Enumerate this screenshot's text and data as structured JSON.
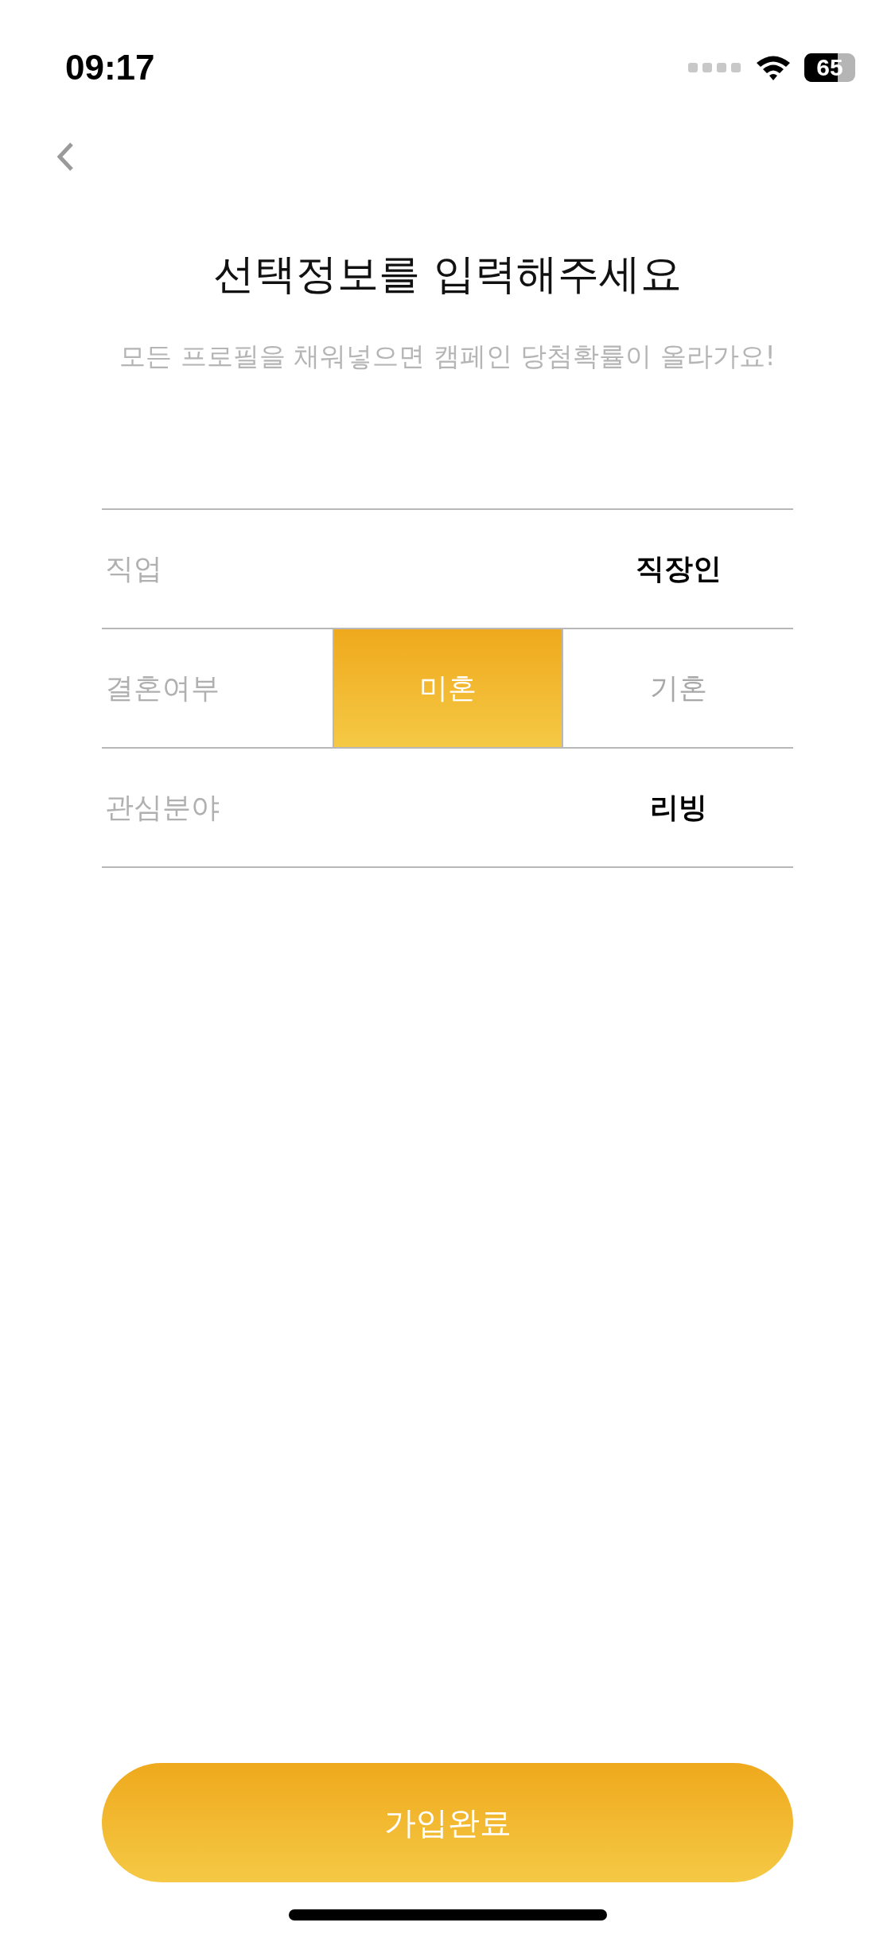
{
  "status_bar": {
    "time": "09:17",
    "battery": "65"
  },
  "title": "선택정보를 입력해주세요",
  "subtitle": "모든 프로필을 채워넣으면 캠페인 당첨확률이 올라가요!",
  "rows": [
    {
      "kind": "value",
      "label": "직업",
      "value": "직장인"
    },
    {
      "kind": "choice",
      "label": "결혼여부",
      "options": [
        {
          "label": "미혼",
          "selected": true
        },
        {
          "label": "기혼",
          "selected": false
        }
      ]
    },
    {
      "kind": "value",
      "label": "관심분야",
      "value": "리빙"
    }
  ],
  "submit_button": "가입완료"
}
